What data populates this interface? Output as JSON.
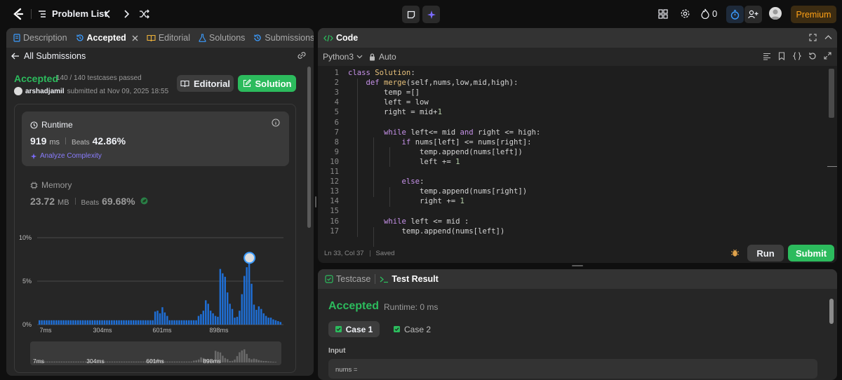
{
  "topbar": {
    "problem_list": "Problem List",
    "streak_count": "0",
    "premium": "Premium"
  },
  "left_panel": {
    "tabs": [
      {
        "label": "Description"
      },
      {
        "label": "Accepted"
      },
      {
        "label": "Editorial"
      },
      {
        "label": "Solutions"
      },
      {
        "label": "Submissions"
      }
    ],
    "all_submissions": "All Submissions",
    "status": "Accepted",
    "testcases": "140 / 140 testcases passed",
    "username": "arshadjamil",
    "submitted_at": "submitted at Nov 09, 2025 18:55",
    "editorial_btn": "Editorial",
    "solution_btn": "Solution",
    "runtime": {
      "label": "Runtime",
      "value": "919",
      "unit": "ms",
      "beats_label": "Beats",
      "beats_value": "42.86%",
      "analyze": "Analyze Complexity"
    },
    "memory": {
      "label": "Memory",
      "value": "23.72",
      "unit": "MB",
      "beats_label": "Beats",
      "beats_value": "69.68%"
    }
  },
  "chart_data": {
    "type": "bar",
    "ytick_labels": [
      "10%",
      "5%",
      "0%"
    ],
    "xtick_labels": [
      "7ms",
      "304ms",
      "601ms",
      "898ms"
    ],
    "ylim": [
      0,
      10
    ],
    "y_ticks": [
      0,
      5,
      10
    ],
    "values": [
      0.5,
      0.5,
      0.5,
      0.5,
      0.5,
      0.5,
      0.5,
      0.5,
      0.5,
      0.5,
      0.5,
      0.5,
      0.5,
      0.5,
      0.5,
      0.5,
      0.5,
      0.5,
      0.5,
      0.5,
      0.5,
      0.5,
      0.5,
      0.5,
      0.5,
      0.5,
      0.5,
      0.5,
      0.5,
      0.5,
      0.5,
      0.5,
      0.5,
      0.5,
      0.5,
      0.5,
      0.5,
      0.5,
      0.5,
      0.5,
      0.5,
      0.5,
      0.5,
      0.5,
      0.5,
      0.5,
      0.5,
      0.5,
      1.5,
      1.6,
      1.3,
      2,
      1.4,
      1,
      0.5,
      0.5,
      0.5,
      0.5,
      0.5,
      0.5,
      0.5,
      0.5,
      0.5,
      0.5,
      0.5,
      0.5,
      1,
      1.2,
      1.6,
      2.8,
      2.4,
      1.6,
      1.3,
      1,
      0.9,
      6.4,
      5.9,
      5.5,
      3.7,
      2.4,
      1.8,
      0.8,
      0.9,
      1.6,
      3.5,
      5.6,
      6.6,
      7.2,
      4.7,
      2.3,
      1.7,
      2.1,
      1.8,
      1.3,
      1,
      0.8,
      0.8,
      0.6,
      0.5,
      0.4,
      0.3
    ],
    "highlight_index": 87
  },
  "editor": {
    "title": "Code",
    "language": "Python3",
    "auto": "Auto",
    "lines": [
      [
        [
          "kw",
          "class "
        ],
        [
          "fn",
          "Solution"
        ],
        [
          "pl",
          ":"
        ]
      ],
      [
        [
          "pl",
          "    "
        ],
        [
          "kw",
          "def "
        ],
        [
          "fn",
          "merge"
        ],
        [
          "pl",
          "(self,nums,low,mid,high):"
        ]
      ],
      [
        [
          "pl",
          "        temp =[]"
        ]
      ],
      [
        [
          "pl",
          "        left = low"
        ]
      ],
      [
        [
          "pl",
          "        right = mid+"
        ],
        [
          "num",
          "1"
        ]
      ],
      [
        [
          "pl",
          ""
        ]
      ],
      [
        [
          "pl",
          "        "
        ],
        [
          "kw",
          "while "
        ],
        [
          "pl",
          "left<= mid "
        ],
        [
          "kw",
          "and "
        ],
        [
          "pl",
          "right <= high:"
        ]
      ],
      [
        [
          "pl",
          "            "
        ],
        [
          "kw",
          "if "
        ],
        [
          "pl",
          "nums[left] <= nums[right]:"
        ]
      ],
      [
        [
          "pl",
          "                temp.append(nums[left])"
        ]
      ],
      [
        [
          "pl",
          "                left += "
        ],
        [
          "num",
          "1"
        ]
      ],
      [
        [
          "pl",
          ""
        ]
      ],
      [
        [
          "pl",
          "            "
        ],
        [
          "kw",
          "else"
        ],
        [
          "pl",
          ":"
        ]
      ],
      [
        [
          "pl",
          "                temp.append(nums[right])"
        ]
      ],
      [
        [
          "pl",
          "                right += "
        ],
        [
          "num",
          "1"
        ]
      ],
      [
        [
          "pl",
          ""
        ]
      ],
      [
        [
          "pl",
          "        "
        ],
        [
          "kw",
          "while "
        ],
        [
          "pl",
          "left <= mid :"
        ]
      ],
      [
        [
          "pl",
          "            temp.append(nums[left])"
        ]
      ]
    ],
    "status_pos": "Ln 33, Col 37",
    "status_saved": "Saved",
    "run": "Run",
    "submit": "Submit"
  },
  "test_panel": {
    "tab_testcase": "Testcase",
    "tab_result": "Test Result",
    "status": "Accepted",
    "runtime": "Runtime: 0 ms",
    "cases": [
      "Case 1",
      "Case 2"
    ],
    "input_label": "Input",
    "nums_label": "nums ="
  }
}
